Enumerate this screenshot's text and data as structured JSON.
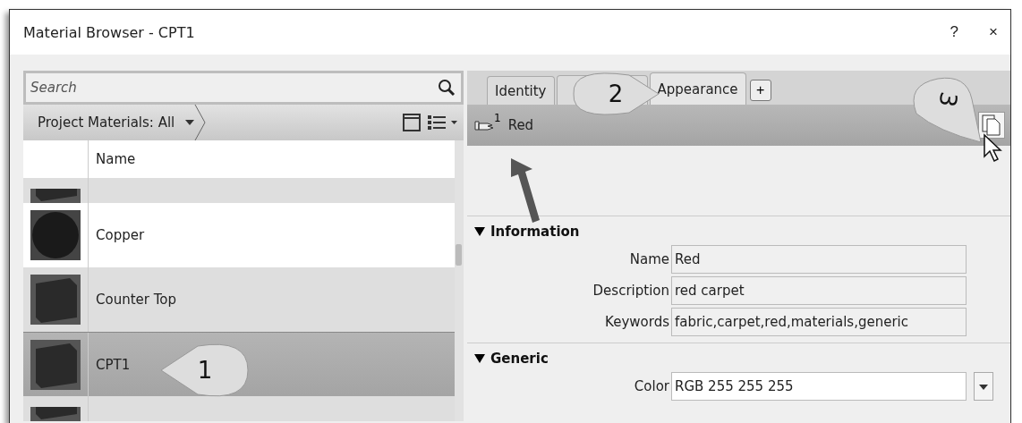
{
  "window": {
    "title": "Material Browser - CPT1",
    "help": "?",
    "close": "×"
  },
  "search": {
    "placeholder": "Search"
  },
  "library": {
    "label": "Project Materials: All"
  },
  "table": {
    "columns": [
      "Name"
    ],
    "rows": [
      {
        "kind": "cube",
        "name": "",
        "selected": false,
        "partial": true
      },
      {
        "kind": "sphere",
        "name": "Copper",
        "selected": false
      },
      {
        "kind": "cube",
        "name": "Counter Top",
        "selected": false
      },
      {
        "kind": "cube",
        "name": "CPT1",
        "selected": true
      },
      {
        "kind": "cube",
        "name": "",
        "selected": false,
        "partial": true
      }
    ]
  },
  "tabs": [
    {
      "label": "Identity",
      "selected": false
    },
    {
      "label": "Appearance",
      "selected": true
    }
  ],
  "tab_add": "+",
  "asset": {
    "users": "1",
    "name": "Red"
  },
  "sections": [
    {
      "title": "Information",
      "expanded": true,
      "fields": [
        {
          "label": "Name",
          "value": "Red"
        },
        {
          "label": "Description",
          "value": "red carpet"
        },
        {
          "label": "Keywords",
          "value": "fabric,carpet,red,materials,generic"
        }
      ]
    },
    {
      "title": "Generic",
      "expanded": true,
      "fields": [
        {
          "label": "Color",
          "value": "RGB 255 255 255",
          "dropdown": true
        }
      ]
    }
  ],
  "callouts": [
    {
      "text": "1"
    },
    {
      "text": "2"
    },
    {
      "text": "3"
    }
  ]
}
